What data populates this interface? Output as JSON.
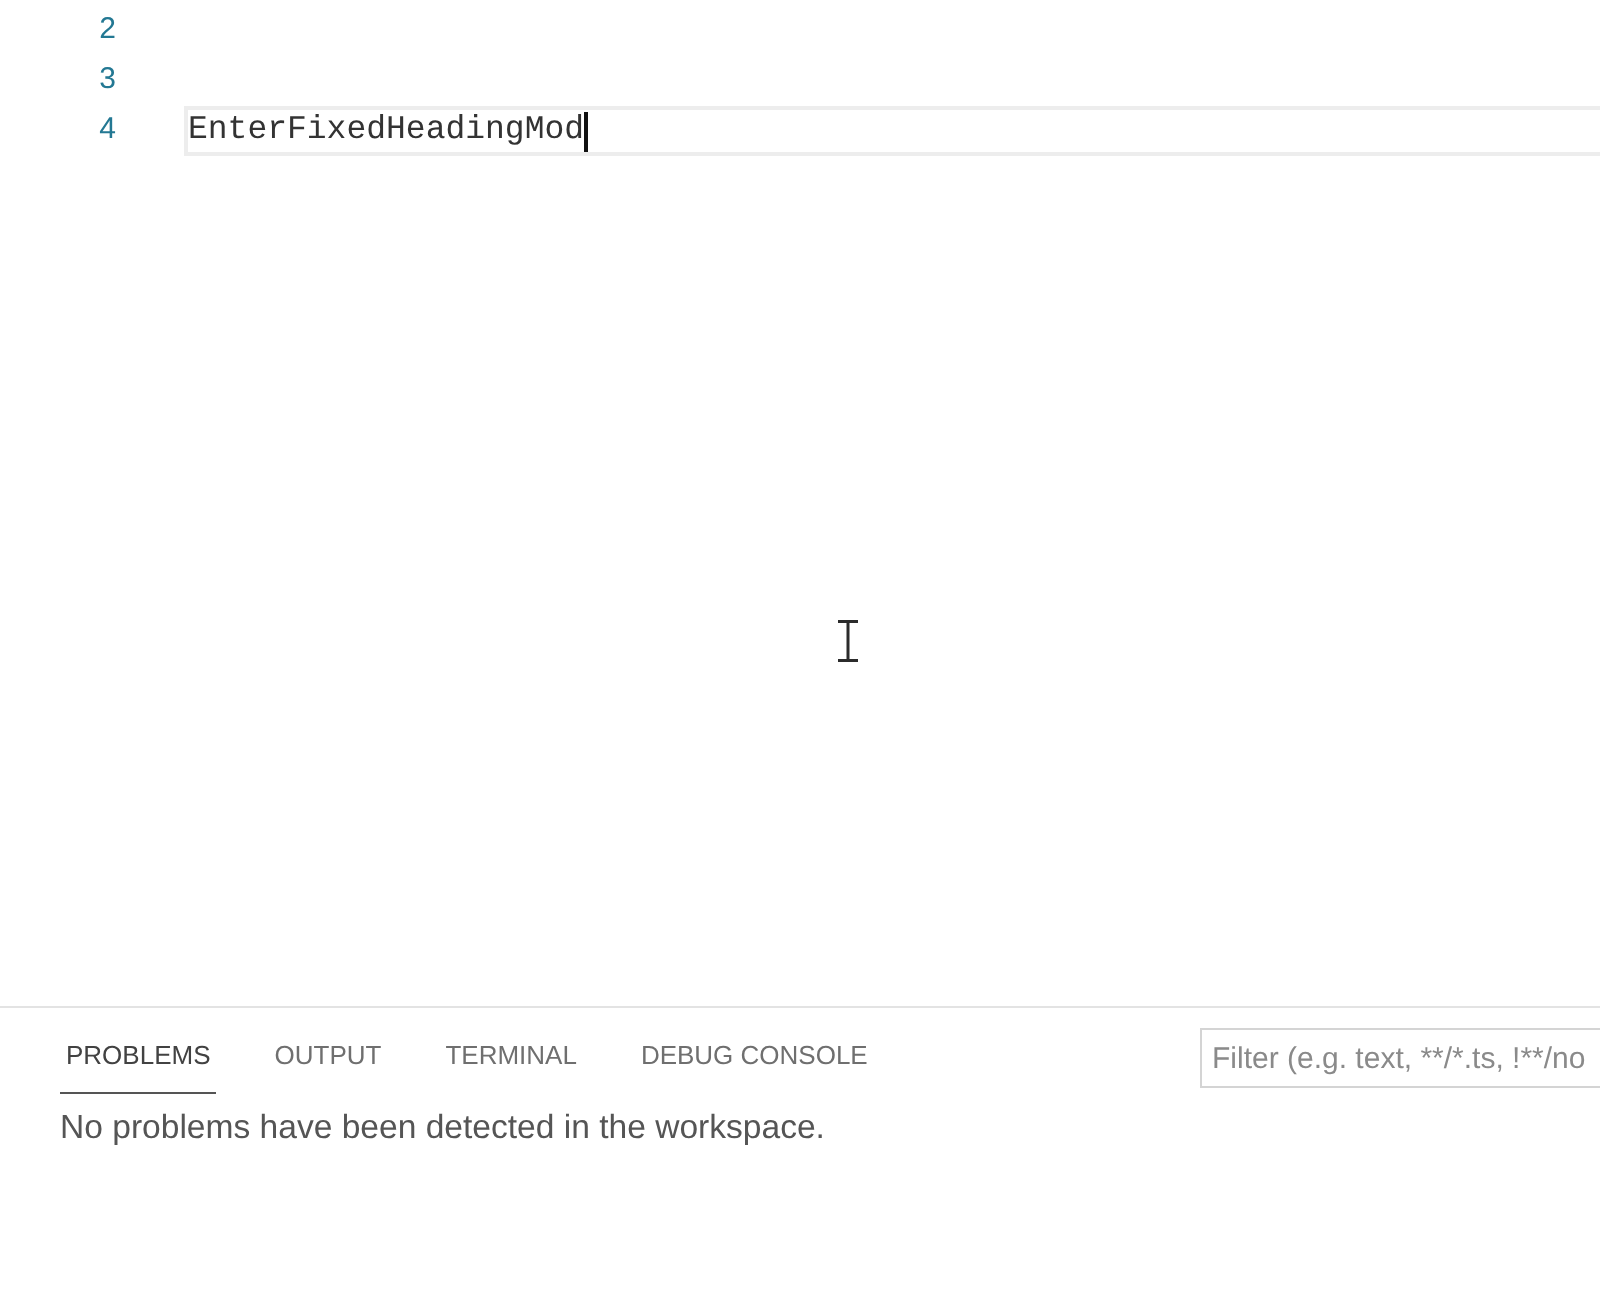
{
  "editor": {
    "lines": [
      {
        "number": "2",
        "current": false
      },
      {
        "number": "3",
        "current": false
      },
      {
        "number": "4",
        "text": "EnterFixedHeadingMod",
        "current": true
      }
    ]
  },
  "panel": {
    "tabs": [
      {
        "label": "PROBLEMS",
        "selected": true
      },
      {
        "label": "OUTPUT",
        "selected": false
      },
      {
        "label": "TERMINAL",
        "selected": false
      },
      {
        "label": "DEBUG CONSOLE",
        "selected": false
      }
    ],
    "filter": {
      "placeholder": "Filter (e.g. text, **/*.ts, !**/no"
    },
    "message": "No problems have been detected in the workspace."
  }
}
